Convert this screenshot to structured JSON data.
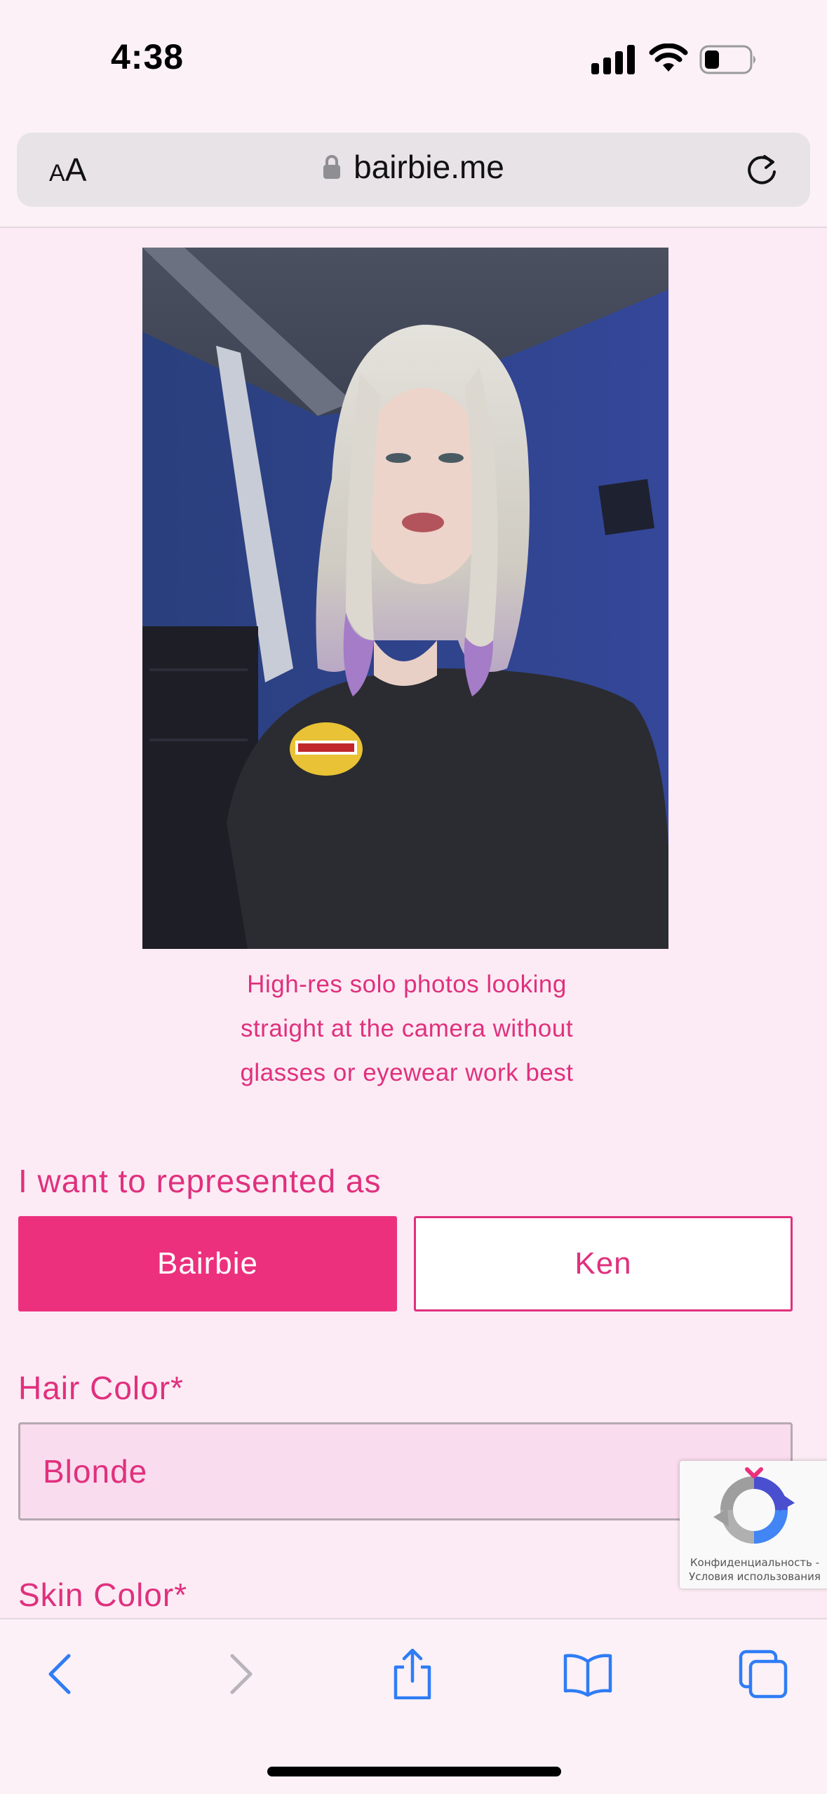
{
  "status_bar": {
    "time": "4:38"
  },
  "browser": {
    "text_size_small": "A",
    "text_size_large": "A",
    "url": "bairbie.me"
  },
  "photo": {
    "caption_lines": [
      "High-res solo photos looking",
      "straight at the camera without",
      "glasses or eyewear work best"
    ]
  },
  "form": {
    "represent_label": "I want to represented as",
    "options": [
      {
        "label": "Bairbie",
        "selected": true
      },
      {
        "label": "Ken",
        "selected": false
      }
    ],
    "hair_color_label": "Hair Color*",
    "hair_color_value": "Blonde",
    "skin_color_label": "Skin Color*"
  },
  "recaptcha": {
    "privacy": "Конфиденциальность",
    "separator": " - ",
    "terms": "Условия использования"
  },
  "colors": {
    "accent": "#ec307d",
    "text_pink": "#e0307e",
    "page_bg": "#fcebf4",
    "select_bg": "#f9dcee",
    "ios_blue": "#2f7cf6"
  },
  "toolbar": {
    "icons": [
      "back-icon",
      "forward-icon",
      "share-icon",
      "bookmarks-icon",
      "tabs-icon"
    ]
  }
}
